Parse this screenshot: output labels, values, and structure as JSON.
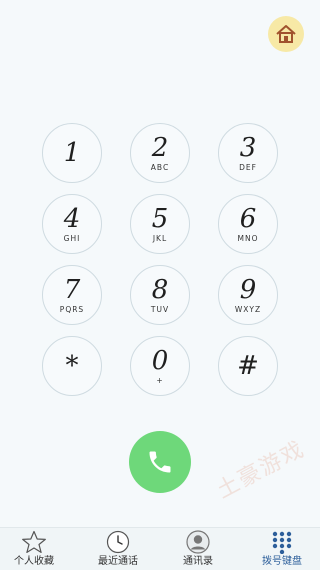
{
  "colors": {
    "background": "#f5f9fb",
    "call_button": "#6ed87a",
    "home_button": "#f7e9a6",
    "active_tab": "#2c5e9a"
  },
  "header": {
    "home_icon": "house-icon"
  },
  "keypad": {
    "keys": [
      {
        "digit": "1",
        "letters": ""
      },
      {
        "digit": "2",
        "letters": "ABC"
      },
      {
        "digit": "3",
        "letters": "DEF"
      },
      {
        "digit": "4",
        "letters": "GHI"
      },
      {
        "digit": "5",
        "letters": "JKL"
      },
      {
        "digit": "6",
        "letters": "MNO"
      },
      {
        "digit": "7",
        "letters": "PQRS"
      },
      {
        "digit": "8",
        "letters": "TUV"
      },
      {
        "digit": "9",
        "letters": "WXYZ"
      },
      {
        "digit": "*",
        "letters": ""
      },
      {
        "digit": "0",
        "letters": "+"
      },
      {
        "digit": "#",
        "letters": ""
      }
    ]
  },
  "call": {
    "icon": "phone-icon"
  },
  "watermark": {
    "text": "土豪游戏"
  },
  "tabbar": {
    "tabs": [
      {
        "label": "个人收藏",
        "icon": "star-icon"
      },
      {
        "label": "最近通话",
        "icon": "clock-icon"
      },
      {
        "label": "通讯录",
        "icon": "contact-icon"
      },
      {
        "label": "拨号键盘",
        "icon": "keypad-icon",
        "active": true
      }
    ]
  }
}
